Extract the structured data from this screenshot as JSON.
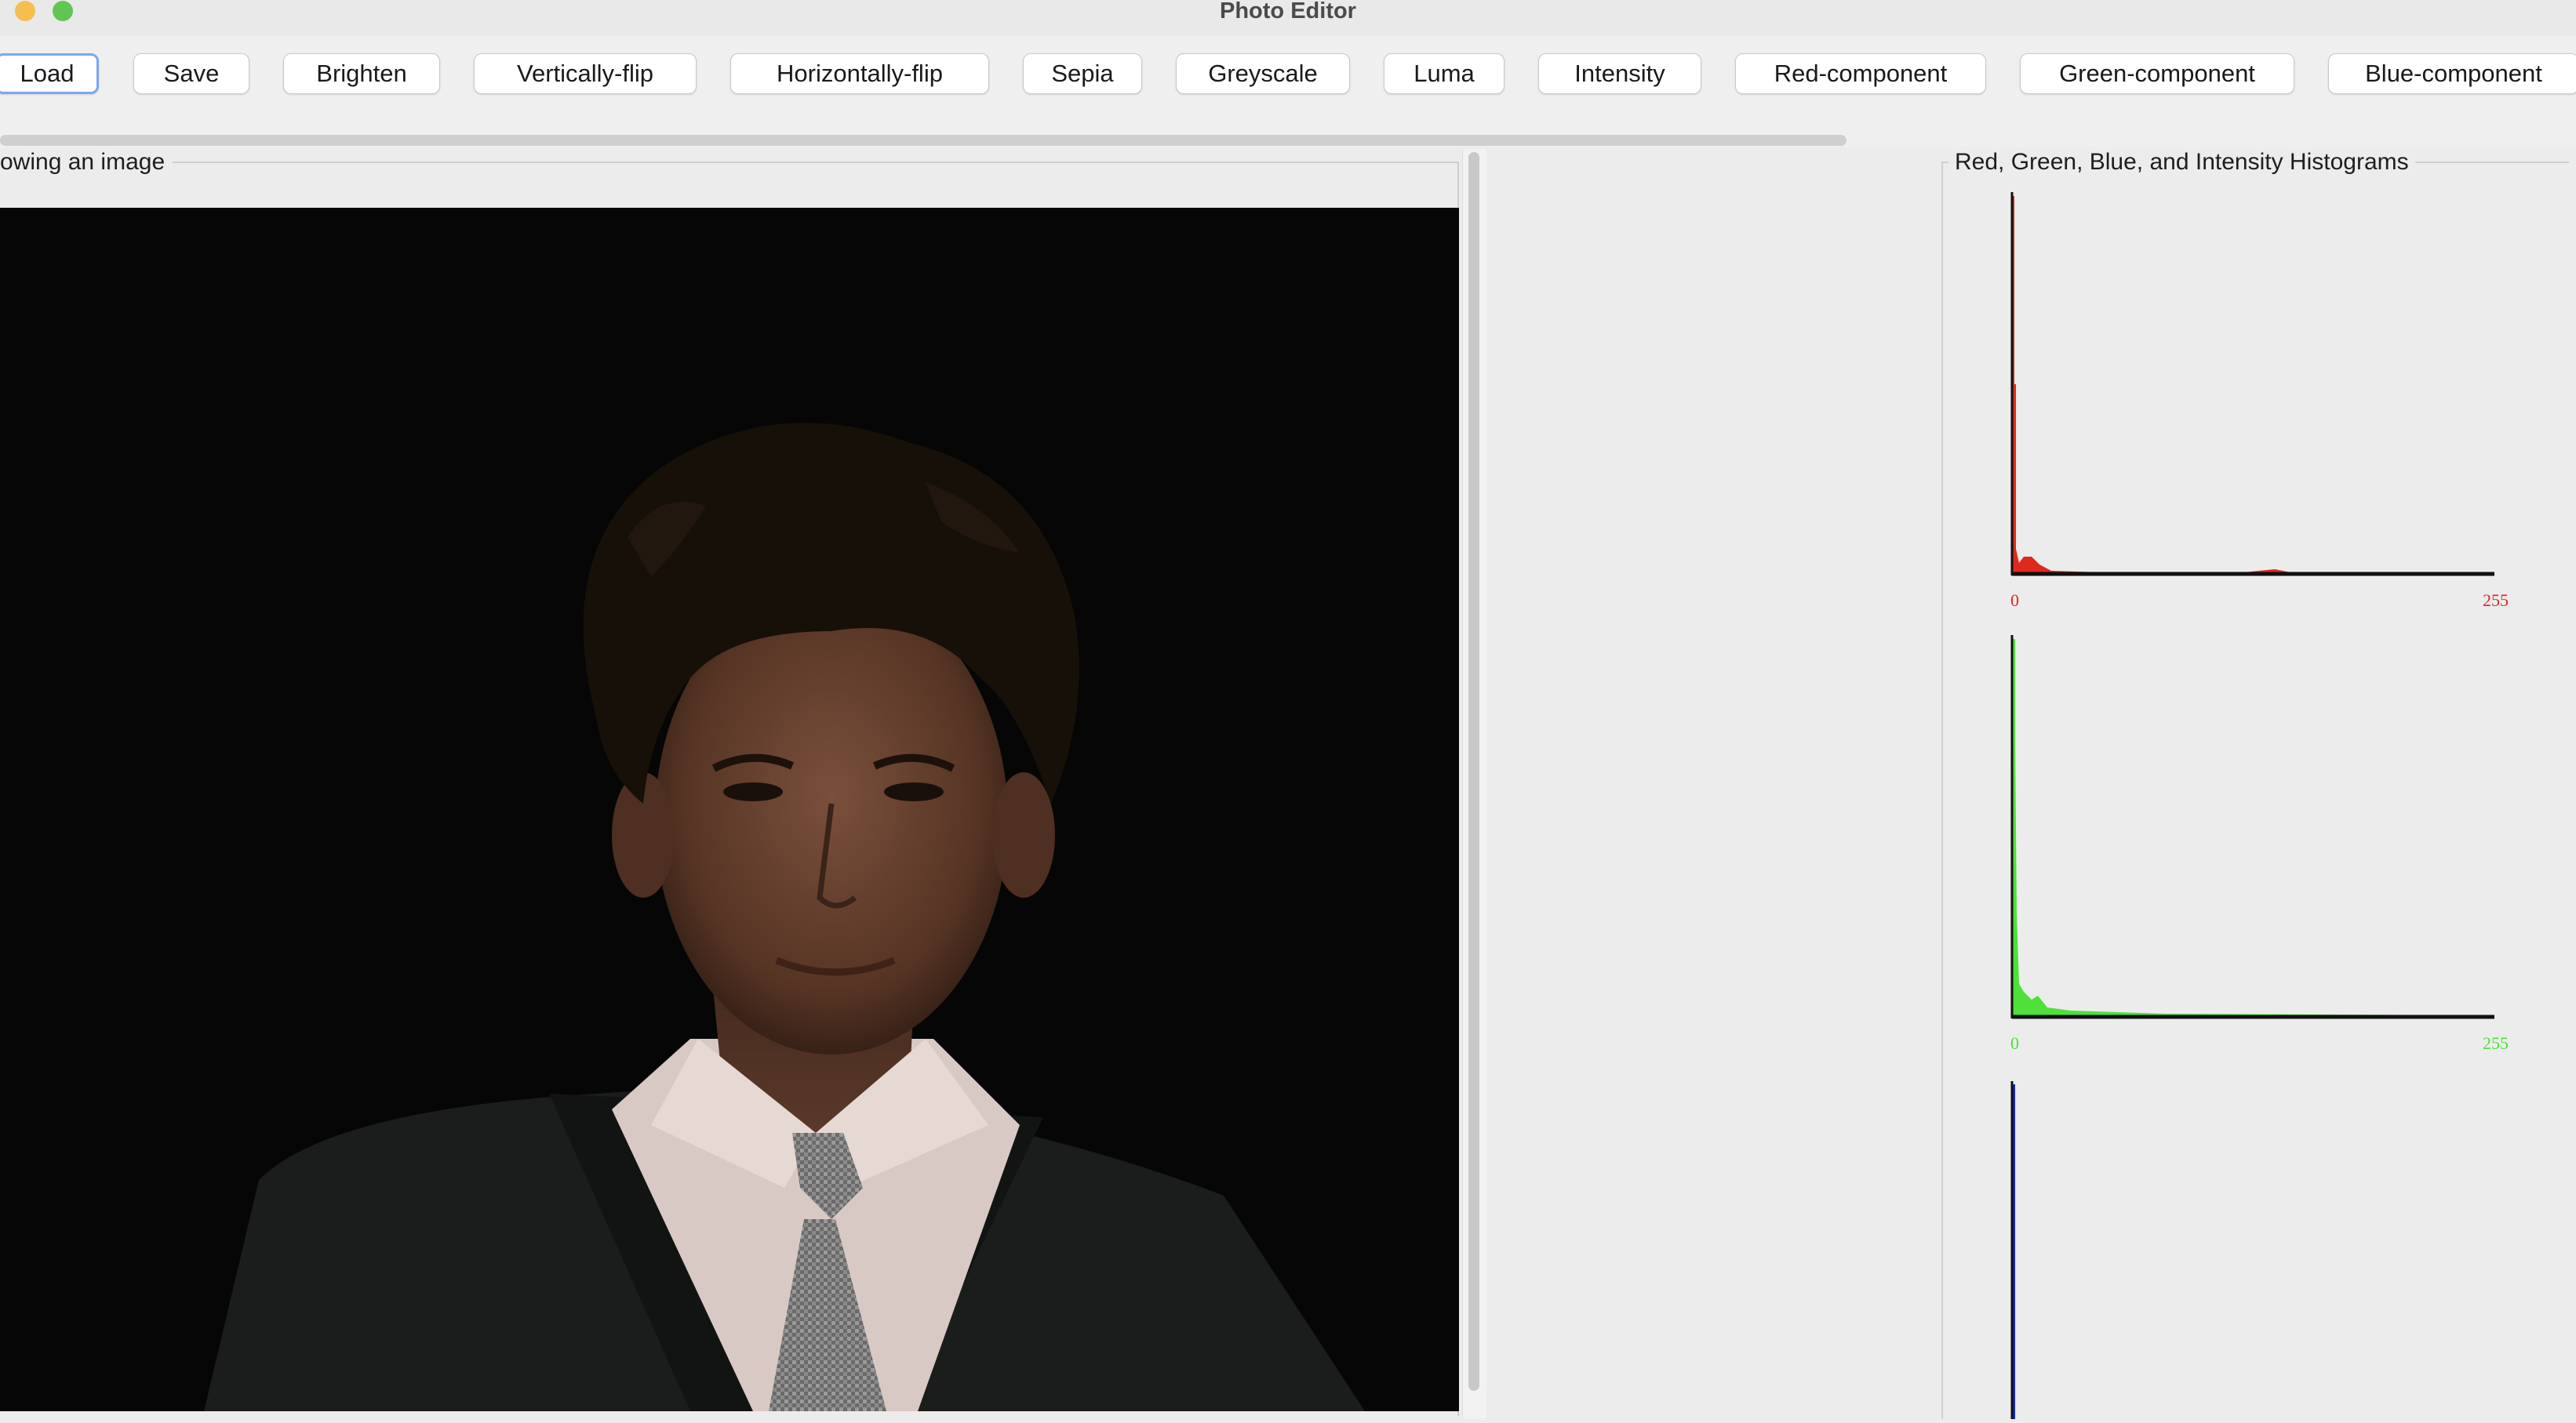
{
  "window": {
    "title": "Photo Editor"
  },
  "toolbar": {
    "buttons": [
      {
        "label": "Load"
      },
      {
        "label": "Save"
      },
      {
        "label": "Brighten"
      },
      {
        "label": "Vertically-flip"
      },
      {
        "label": "Horizontally-flip"
      },
      {
        "label": "Sepia"
      },
      {
        "label": "Greyscale"
      },
      {
        "label": "Luma"
      },
      {
        "label": "Intensity"
      },
      {
        "label": "Red-component"
      },
      {
        "label": "Green-component"
      },
      {
        "label": "Blue-component"
      }
    ]
  },
  "image_panel": {
    "label": "owing an image"
  },
  "histogram_panel": {
    "label": "Red, Green, Blue, and Intensity Histograms",
    "histograms": [
      {
        "name": "red",
        "color": "#e0291d",
        "min_label": "0",
        "max_label": "255"
      },
      {
        "name": "green",
        "color": "#4fe03a",
        "min_label": "0",
        "max_label": "255"
      },
      {
        "name": "blue",
        "color": "#1024c8"
      }
    ]
  }
}
